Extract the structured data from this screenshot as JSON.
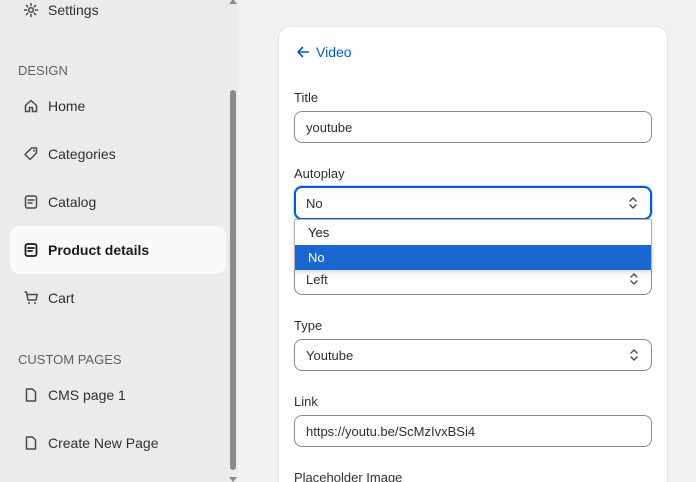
{
  "sidebar": {
    "settings_label": "Settings",
    "design_title": "DESIGN",
    "items": [
      {
        "label": "Home",
        "icon": "home-icon"
      },
      {
        "label": "Categories",
        "icon": "tag-icon"
      },
      {
        "label": "Catalog",
        "icon": "catalog-icon"
      },
      {
        "label": "Product details",
        "icon": "product-icon",
        "active": true
      },
      {
        "label": "Cart",
        "icon": "cart-icon"
      }
    ],
    "custom_pages_title": "CUSTOM PAGES",
    "custom_pages": [
      {
        "label": "CMS page 1",
        "icon": "page-icon"
      },
      {
        "label": "Create New Page",
        "icon": "page-icon"
      }
    ]
  },
  "editor": {
    "back_label": "Video",
    "fields": {
      "title": {
        "label": "Title",
        "value": "youtube"
      },
      "autoplay": {
        "label": "Autoplay",
        "value": "No",
        "options": [
          "Yes",
          "No"
        ]
      },
      "alignment": {
        "value": "Left"
      },
      "type": {
        "label": "Type",
        "value": "Youtube"
      },
      "link": {
        "label": "Link",
        "value": "https://youtu.be/ScMzIvxBSi4"
      },
      "placeholder": {
        "label": "Placeholder Image"
      }
    }
  },
  "colors": {
    "accent": "#005bd3",
    "selected_option": "#1a66d2",
    "sidebar_bg": "#ebebeb"
  }
}
